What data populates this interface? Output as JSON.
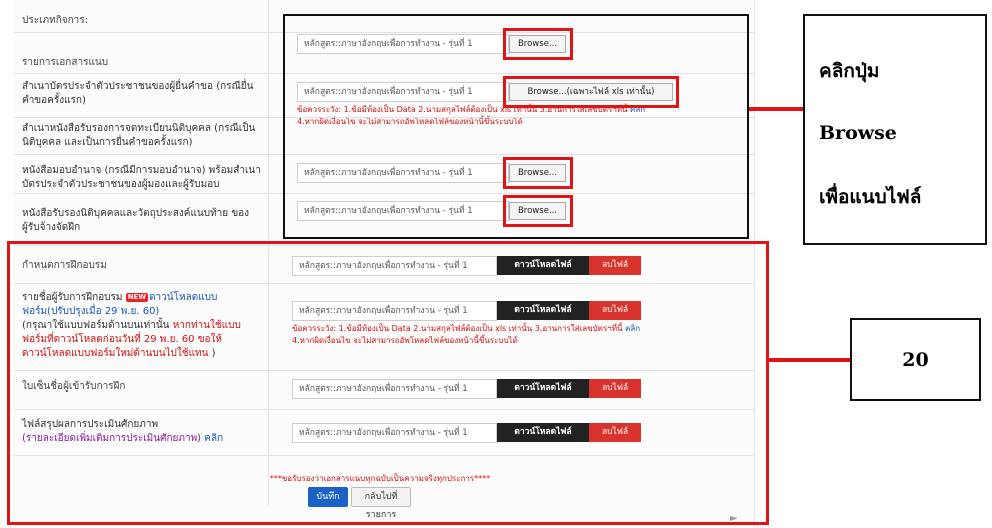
{
  "header": {
    "business_type_label": "ประเภทกิจการ:",
    "attachments_label": "รายการเอกสารแนบ"
  },
  "upload_section": {
    "rows": [
      {
        "label": "สำเนาบัตรประจำตัวประชาชนของผู้ยื่นคำขอ (กรณียื่นคำขอครั้งแรก)",
        "file_value": "หลักสูตร::ภาษาอังกฤษเพื่อการทำงาน - รุ่นที่ 1",
        "browse_label": "Browse...(เฉพาะไฟล์ xls เท่านั้น)",
        "note": "ข้อควรระวัง: 1.ข้อมีท้องเป็น Data 2.นามสกุลไฟล์ต้องเป็น xls เท่านั้น 3.อานการใส่เลขบัตรฯที่นี้",
        "note_link": "คลิก",
        "note2": "4.หากผิดเงื่อนไข จะไม่สามารถอัพโหลดไฟล์ของหน้านี้ขึ้นระบบได้"
      },
      {
        "label": "สำเนาหนังสือรับรองการจดทะเบียนนิติบุคคล (กรณีเป็นนิติบุคคล และเป็นการยื่นคำขอครั้งแรก)"
      },
      {
        "label": "หนังสือมอบอำนาจ (กรณีมีการมอบอำนาจ) พร้อมสำเนาบัตรประจำตัวประชาชนของผู้มองและผู้รับมอบ",
        "file_value": "หลักสูตร::ภาษาอังกฤษเพื่อการทำงาน - รุ่นที่ 1",
        "browse_label": "Browse..."
      },
      {
        "label": "หนังสือรับรองนิติบุคคลและวัตถุประสงค์แนบท้าย ของผู้รับจ้างจัดฝึก",
        "file_value": "หลักสูตร::ภาษาอังกฤษเพื่อการทำงาน - รุ่นที่ 1",
        "browse_label": "Browse..."
      }
    ],
    "first_file_value": "หลักสูตร::ภาษาอังกฤษเพื่อการทำงาน - รุ่นที่ 1",
    "first_browse_label": "Browse..."
  },
  "download_section": {
    "schedule_label": "กำหนดการฝึกอบรม",
    "trainees_label_a": "รายชื่อผู้รับการฝึกอบรม",
    "new_badge": "NEW",
    "trainees_link": "ดาวน์โหลดแบบฟอร์ม(ปรับปรุงเมื่อ 29 พ.ย. 60)",
    "trainees_note_a": "(กรุณาใช้แบบฟอร์มด้านบนเท่านั้น",
    "trainees_note_red": "หากท่านใช้แบบฟอร์มที่ดาวน์โหลดก่อนวันที่ 29 พ.ย. 60 ขอให้ดาวน์โหลดแบบฟอร์มใหม่ด้านบนไปใช้แทน",
    "trainees_note_b": ")",
    "signin_label": "ใบเซ็นชื่อผู้เข้ารับการฝึก",
    "assessment_label": "ไฟล์สรุปผลการประเมินศักยภาพ",
    "assessment_sub": "(รายละเอียดเพิ่มเติมการประเมินศักยภาพ)",
    "assessment_link": "คลิก",
    "file_value": "หลักสูตร::ภาษาอังกฤษเพื่อการทำงาน - รุ่นที่ 1",
    "download_label": "ดาวน์โหลดไฟล์",
    "delete_label": "ลบไฟล์",
    "note": "ข้อควรระวัง: 1.ข้อมีท้องเป็น Data 2.นามสกุลไฟล์ต้องเป็น xls เท่านั้น 3.อานการใส่เลขบัตรฯที่นี้",
    "note_link": "คลิก",
    "note2": "4.หากผิดเงื่อนไข จะไม่สามารถอัพโหลดไฟล์ของหน้านี้ขึ้นระบบได้"
  },
  "footer": {
    "confirm_text": "***ขอรับรองว่าเอกสารแนบทุกฉบับเป็นความจริงทุกประการ****",
    "save_label": "บันทึก",
    "back_label": "กลับไปที่รายการ"
  },
  "annotations": {
    "callout_line1": "คลิกปุ่ม",
    "callout_line2": "Browse",
    "callout_line3": "เพื่อแนบไฟล์",
    "step_number": "20"
  },
  "colors": {
    "highlight": "#e01414",
    "download_button": "#222222",
    "delete_button": "#d9332e",
    "save_button": "#1b62c7",
    "link": "#1a55b8"
  }
}
